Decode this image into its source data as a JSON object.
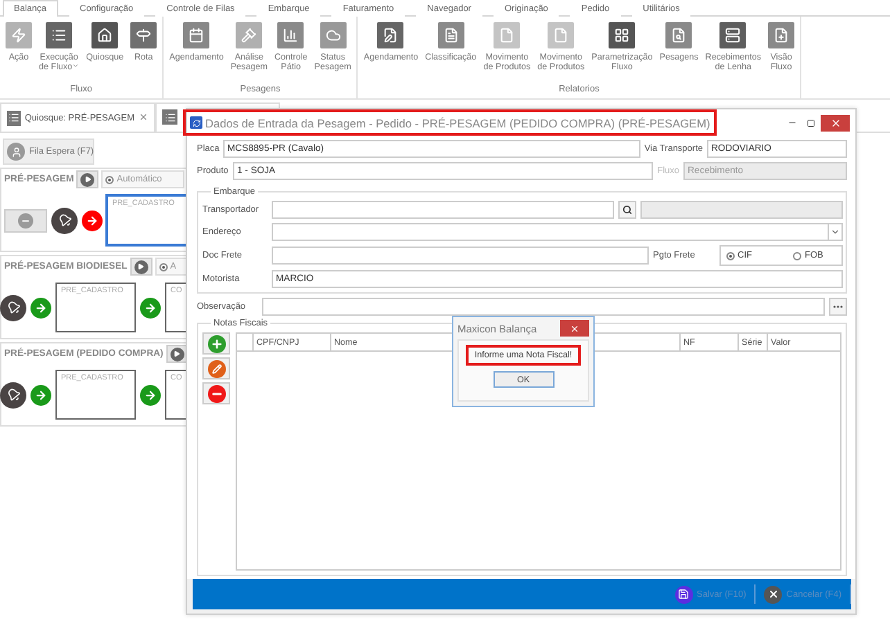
{
  "menu_tabs": [
    {
      "label": "Balança",
      "selected": true
    },
    {
      "label": "Configuração",
      "selected": false
    },
    {
      "label": "Controle de Filas",
      "selected": false
    },
    {
      "label": "Embarque",
      "selected": false
    },
    {
      "label": "Faturamento",
      "selected": false
    },
    {
      "label": "Navegador",
      "selected": false
    },
    {
      "label": "Originação",
      "selected": false
    },
    {
      "label": "Pedido",
      "selected": false
    },
    {
      "label": "Utilitários",
      "selected": false
    }
  ],
  "ribbon": [
    {
      "label": "Fluxo",
      "items": [
        {
          "label": "Ação"
        },
        {
          "label": "Execução\nde Fluxo",
          "dropdown": true
        },
        {
          "label": "Quiosque"
        },
        {
          "label": "Rota"
        }
      ]
    },
    {
      "label": "Pesagens",
      "items": [
        {
          "label": "Agendamento"
        },
        {
          "label": "Análise\nPesagem"
        },
        {
          "label": "Controle\nPátio"
        },
        {
          "label": "Status\nPesagem"
        }
      ]
    },
    {
      "label": "Relatorios",
      "items": [
        {
          "label": "Agendamento"
        },
        {
          "label": "Classificação"
        },
        {
          "label": "Movimento\nde Produtos"
        },
        {
          "label": "Movimento\nde Produtos"
        },
        {
          "label": "Parametrização\nFluxo"
        },
        {
          "label": "Pesagens"
        },
        {
          "label": "Recebimentos\nde Lenha"
        },
        {
          "label": "Visão\nFluxo"
        }
      ]
    }
  ],
  "doc_tabs": [
    {
      "label": "Quiosque: PRÉ-PESAGEM",
      "selected": true
    }
  ],
  "queue_button": "Fila Espera (F7)",
  "stations": [
    {
      "title": "PRÉ-PESAGEM",
      "mode": {
        "label": "Automático",
        "selected": true
      },
      "flow": [
        {
          "kind": "stop"
        },
        {
          "kind": "bell"
        },
        {
          "kind": "arrow",
          "color": "#ff0000"
        },
        {
          "kind": "stage",
          "label": "PRE_CADASTRO",
          "selected": true
        }
      ]
    },
    {
      "title": "PRÉ-PESAGEM BIODIESEL",
      "mode": {
        "label": "A",
        "selected": true
      },
      "flow": [
        {
          "kind": "bell"
        },
        {
          "kind": "arrow",
          "color": "#1a9a1a"
        },
        {
          "kind": "stage",
          "label": "PRE_CADASTRO",
          "selected": false
        },
        {
          "kind": "arrow",
          "color": "#1a9a1a"
        },
        {
          "kind": "stage",
          "label": "CO",
          "selected": false
        }
      ]
    },
    {
      "title": "PRÉ-PESAGEM (PEDIDO COMPRA)",
      "flow": [
        {
          "kind": "bell"
        },
        {
          "kind": "arrow",
          "color": "#1a9a1a"
        },
        {
          "kind": "stage",
          "label": "PRE_CADASTRO",
          "selected": false
        },
        {
          "kind": "arrow",
          "color": "#1a9a1a"
        },
        {
          "kind": "stage",
          "label": "CO",
          "selected": false
        }
      ]
    }
  ],
  "dialog": {
    "title": "Dados de Entrada da Pesagem - Pedido - PRÉ-PESAGEM (PEDIDO COMPRA) (PRÉ-PESAGEM)",
    "placa": {
      "label": "Placa",
      "value": "MCS8895-PR (Cavalo)"
    },
    "via_transporte": {
      "label": "Via Transporte",
      "value": "RODOVIARIO"
    },
    "produto": {
      "label": "Produto",
      "value": "1 - SOJA"
    },
    "fluxo": {
      "label": "Fluxo",
      "value": "Recebimento",
      "disabled": true
    },
    "embarque": {
      "title": "Embarque",
      "transportador": {
        "label": "Transportador"
      },
      "endereco": {
        "label": "Endereço"
      },
      "doc_frete": {
        "label": "Doc Frete"
      },
      "pgto_frete": {
        "label": "Pgto Frete",
        "options": [
          {
            "label": "CIF",
            "selected": true
          },
          {
            "label": "FOB",
            "selected": false
          }
        ]
      },
      "motorista": {
        "label": "Motorista",
        "value": "MARCIO"
      }
    },
    "observacao": {
      "label": "Observação"
    },
    "notas": {
      "title": "Notas Fiscais",
      "columns": [
        "CPF/CNPJ",
        "Nome",
        "NF",
        "Série",
        "Valor"
      ]
    },
    "footer_buttons": [
      "Salvar (F10)",
      "Cancelar (F4)"
    ]
  },
  "message_box": {
    "title": "Maxicon Balança",
    "message": "Informe uma Nota Fiscal!",
    "button": "OK"
  }
}
